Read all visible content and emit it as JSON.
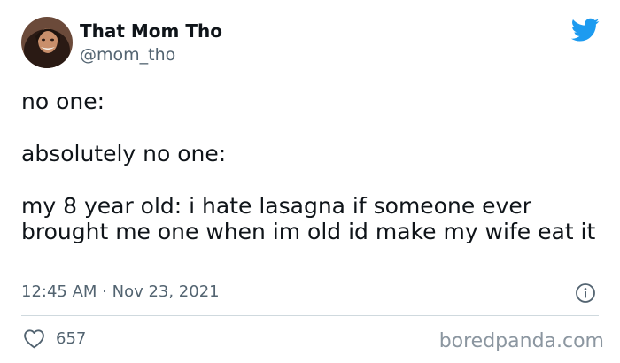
{
  "author": {
    "display_name": "That Mom Tho",
    "handle": "@mom_tho"
  },
  "tweet": {
    "lines": [
      "no one:",
      "absolutely no one:",
      "my 8 year old: i hate lasagna if someone ever brought me one when im old id make my wife eat it"
    ],
    "timestamp": "12:45 AM · Nov 23, 2021"
  },
  "engagement": {
    "likes": "657"
  },
  "icons": {
    "brand": "twitter-bird-icon",
    "info": "info-icon",
    "like": "heart-icon"
  },
  "colors": {
    "twitter_blue": "#1d9bf0",
    "secondary_text": "#536471",
    "divider": "#cfd9de"
  },
  "watermark": "boredpanda.com"
}
